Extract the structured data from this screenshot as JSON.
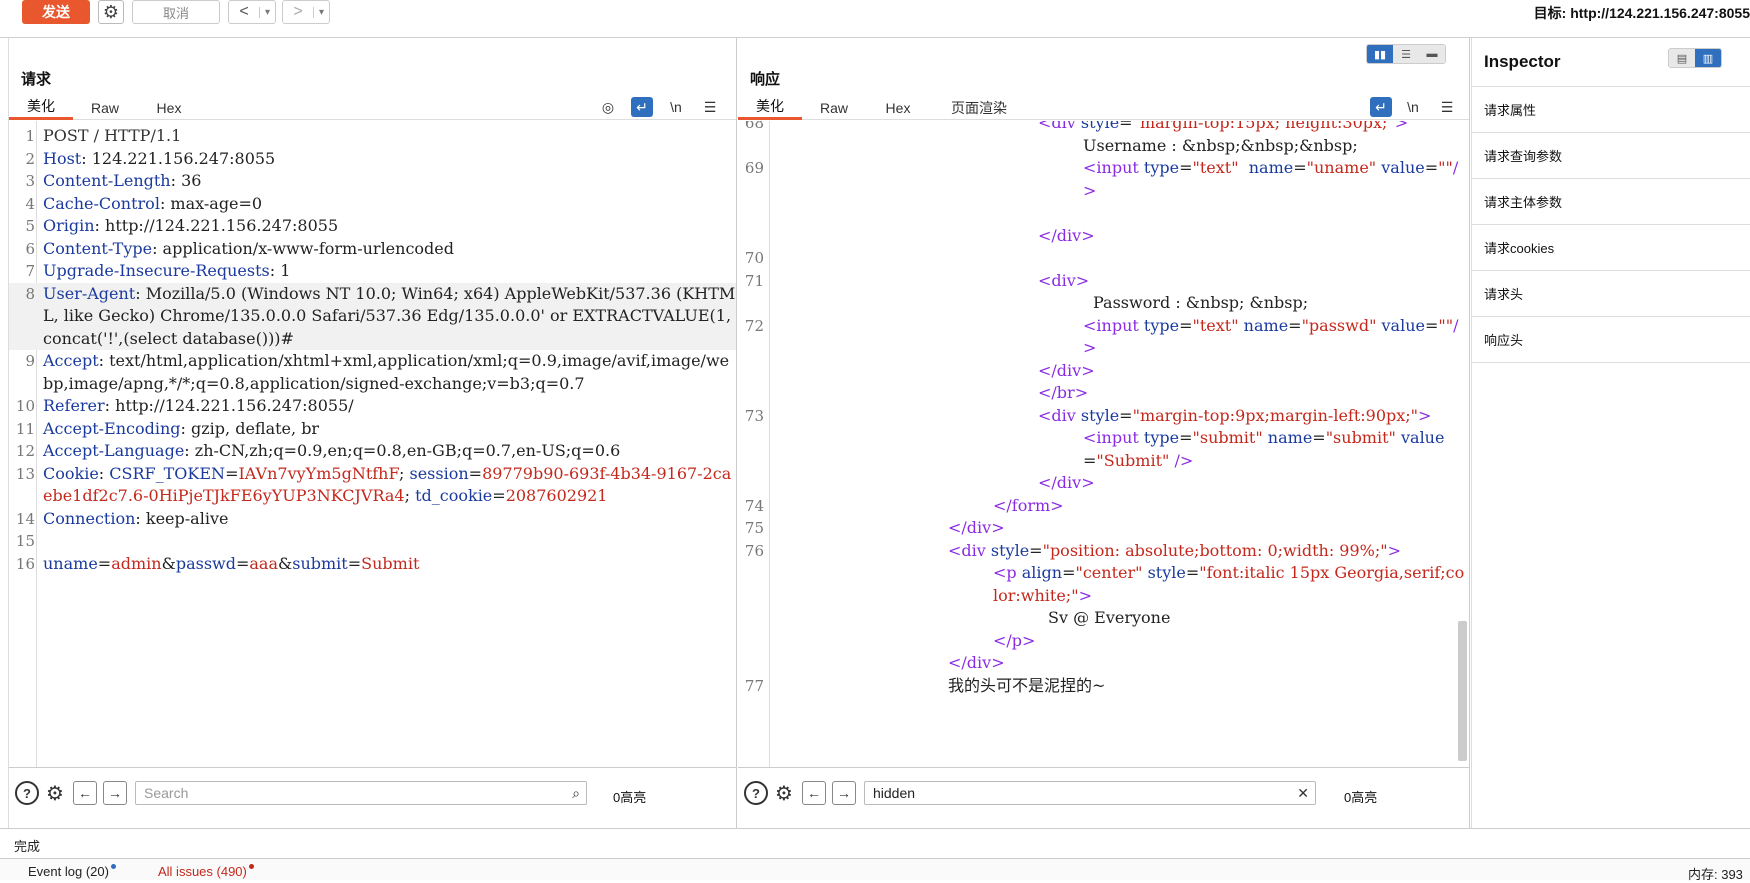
{
  "toolbar": {
    "send_label": "发送",
    "cancel_label": "取消",
    "back_arrow": "<",
    "forward_arrow": ">",
    "target_label": "目标: http://124.221.156.247:8055"
  },
  "request": {
    "title": "请求",
    "tabs": [
      "美化",
      "Raw",
      "Hex"
    ],
    "icons": [
      "eye-slash-icon",
      "wrap-icon",
      "newline-icon",
      "menu-icon"
    ],
    "newline_glyph": "\\n",
    "search_placeholder": "Search",
    "highlight_count": "0高亮"
  },
  "response": {
    "title": "响应",
    "tabs": [
      "美化",
      "Raw",
      "Hex",
      "页面渲染"
    ],
    "newline_glyph": "\\n",
    "search_value": "hidden",
    "highlight_count": "0高亮"
  },
  "inspector": {
    "title": "Inspector",
    "items": [
      "请求属性",
      "请求查询参数",
      "请求主体参数",
      "请求cookies",
      "请求头",
      "响应头"
    ]
  },
  "status": {
    "text": "完成"
  },
  "bottom": {
    "event_log": "Event log (20)",
    "all_issues": "All issues (490)",
    "memory": "内存: 393"
  },
  "colors": {
    "accent": "#e8572e",
    "blue": "#2f6fbd",
    "key": "#1a3a9e",
    "value": "#c4281c",
    "tag": "#8a2be2"
  }
}
